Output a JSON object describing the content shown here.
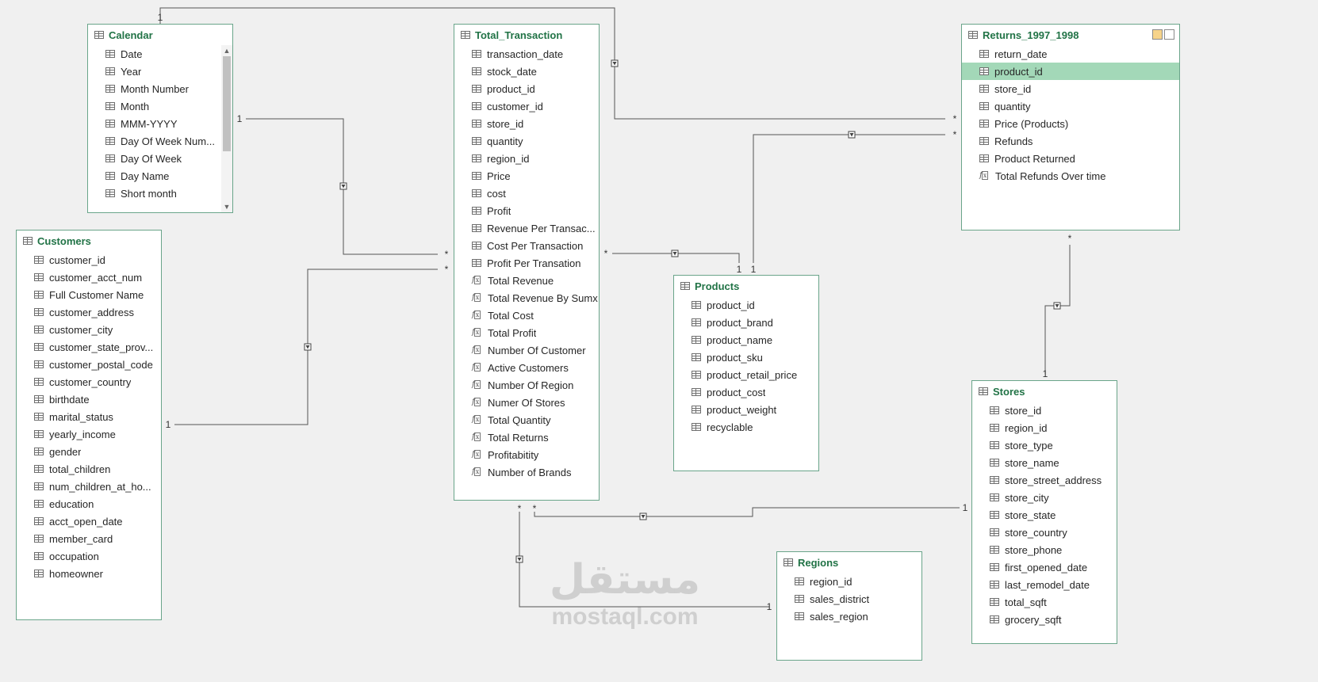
{
  "tables": [
    {
      "id": "calendar",
      "name": "Calendar",
      "scroll": true,
      "fields": [
        {
          "label": "Date",
          "kind": "col"
        },
        {
          "label": "Year",
          "kind": "col"
        },
        {
          "label": "Month Number",
          "kind": "col"
        },
        {
          "label": "Month",
          "kind": "col"
        },
        {
          "label": "MMM-YYYY",
          "kind": "col"
        },
        {
          "label": "Day Of Week Num...",
          "kind": "col"
        },
        {
          "label": "Day Of Week",
          "kind": "col"
        },
        {
          "label": "Day Name",
          "kind": "col"
        },
        {
          "label": "Short month",
          "kind": "col"
        }
      ]
    },
    {
      "id": "total_transaction",
      "name": "Total_Transaction",
      "fields": [
        {
          "label": "transaction_date",
          "kind": "col"
        },
        {
          "label": "stock_date",
          "kind": "col"
        },
        {
          "label": "product_id",
          "kind": "col"
        },
        {
          "label": "customer_id",
          "kind": "col"
        },
        {
          "label": "store_id",
          "kind": "col"
        },
        {
          "label": "quantity",
          "kind": "col"
        },
        {
          "label": "region_id",
          "kind": "col"
        },
        {
          "label": "Price",
          "kind": "col"
        },
        {
          "label": "cost",
          "kind": "col"
        },
        {
          "label": "Profit",
          "kind": "col"
        },
        {
          "label": "Revenue Per Transac...",
          "kind": "col"
        },
        {
          "label": "Cost Per Transaction",
          "kind": "col"
        },
        {
          "label": "Profit Per Transation",
          "kind": "col"
        },
        {
          "label": "Total Revenue",
          "kind": "measure"
        },
        {
          "label": "Total Revenue By Sumx",
          "kind": "measure"
        },
        {
          "label": "Total Cost",
          "kind": "measure"
        },
        {
          "label": "Total Profit",
          "kind": "measure"
        },
        {
          "label": "Number Of Customer",
          "kind": "measure"
        },
        {
          "label": "Active Customers",
          "kind": "measure"
        },
        {
          "label": "Number Of Region",
          "kind": "measure"
        },
        {
          "label": "Numer Of Stores",
          "kind": "measure"
        },
        {
          "label": "Total Quantity",
          "kind": "measure"
        },
        {
          "label": "Total Returns",
          "kind": "measure"
        },
        {
          "label": "Profitabitity",
          "kind": "measure"
        },
        {
          "label": "Number of Brands",
          "kind": "measure"
        }
      ]
    },
    {
      "id": "returns",
      "name": "Returns_1997_1998",
      "buttons": true,
      "fields": [
        {
          "label": "return_date",
          "kind": "col"
        },
        {
          "label": "product_id",
          "kind": "col",
          "selected": true
        },
        {
          "label": "store_id",
          "kind": "col"
        },
        {
          "label": "quantity",
          "kind": "col"
        },
        {
          "label": "Price (Products)",
          "kind": "col"
        },
        {
          "label": "Refunds",
          "kind": "col"
        },
        {
          "label": "Product Returned",
          "kind": "col"
        },
        {
          "label": "Total Refunds Over time",
          "kind": "measure"
        }
      ]
    },
    {
      "id": "customers",
      "name": "Customers",
      "fields": [
        {
          "label": "customer_id",
          "kind": "col"
        },
        {
          "label": "customer_acct_num",
          "kind": "col"
        },
        {
          "label": "Full Customer Name",
          "kind": "col"
        },
        {
          "label": "customer_address",
          "kind": "col"
        },
        {
          "label": "customer_city",
          "kind": "col"
        },
        {
          "label": "customer_state_prov...",
          "kind": "col"
        },
        {
          "label": "customer_postal_code",
          "kind": "col"
        },
        {
          "label": "customer_country",
          "kind": "col"
        },
        {
          "label": "birthdate",
          "kind": "col"
        },
        {
          "label": "marital_status",
          "kind": "col"
        },
        {
          "label": "yearly_income",
          "kind": "col"
        },
        {
          "label": "gender",
          "kind": "col"
        },
        {
          "label": "total_children",
          "kind": "col"
        },
        {
          "label": "num_children_at_ho...",
          "kind": "col"
        },
        {
          "label": "education",
          "kind": "col"
        },
        {
          "label": "acct_open_date",
          "kind": "col"
        },
        {
          "label": "member_card",
          "kind": "col"
        },
        {
          "label": "occupation",
          "kind": "col"
        },
        {
          "label": "homeowner",
          "kind": "col"
        }
      ]
    },
    {
      "id": "products",
      "name": "Products",
      "fields": [
        {
          "label": "product_id",
          "kind": "col"
        },
        {
          "label": "product_brand",
          "kind": "col"
        },
        {
          "label": "product_name",
          "kind": "col"
        },
        {
          "label": "product_sku",
          "kind": "col"
        },
        {
          "label": "product_retail_price",
          "kind": "col"
        },
        {
          "label": "product_cost",
          "kind": "col"
        },
        {
          "label": "product_weight",
          "kind": "col"
        },
        {
          "label": "recyclable",
          "kind": "col"
        }
      ]
    },
    {
      "id": "stores",
      "name": "Stores",
      "fields": [
        {
          "label": "store_id",
          "kind": "col"
        },
        {
          "label": "region_id",
          "kind": "col"
        },
        {
          "label": "store_type",
          "kind": "col"
        },
        {
          "label": "store_name",
          "kind": "col"
        },
        {
          "label": "store_street_address",
          "kind": "col"
        },
        {
          "label": "store_city",
          "kind": "col"
        },
        {
          "label": "store_state",
          "kind": "col"
        },
        {
          "label": "store_country",
          "kind": "col"
        },
        {
          "label": "store_phone",
          "kind": "col"
        },
        {
          "label": "first_opened_date",
          "kind": "col"
        },
        {
          "label": "last_remodel_date",
          "kind": "col"
        },
        {
          "label": "total_sqft",
          "kind": "col"
        },
        {
          "label": "grocery_sqft",
          "kind": "col"
        }
      ]
    },
    {
      "id": "regions",
      "name": "Regions",
      "fields": [
        {
          "label": "region_id",
          "kind": "col"
        },
        {
          "label": "sales_district",
          "kind": "col"
        },
        {
          "label": "sales_region",
          "kind": "col"
        }
      ]
    }
  ],
  "relationships": [
    {
      "from": "calendar",
      "to": "returns",
      "from_card": "1",
      "to_card": "*"
    },
    {
      "from": "calendar",
      "to": "total_transaction",
      "from_card": "1",
      "to_card": "*"
    },
    {
      "from": "customers",
      "to": "total_transaction",
      "from_card": "1",
      "to_card": "*"
    },
    {
      "from": "products",
      "to": "total_transaction",
      "from_card": "1",
      "to_card": "*"
    },
    {
      "from": "products",
      "to": "returns",
      "from_card": "1",
      "to_card": "*"
    },
    {
      "from": "stores",
      "to": "returns",
      "from_card": "1",
      "to_card": "*"
    },
    {
      "from": "stores",
      "to": "total_transaction",
      "from_card": "1",
      "to_card": "*"
    },
    {
      "from": "regions",
      "to": "total_transaction",
      "from_card": "1",
      "to_card": "*"
    }
  ],
  "watermark": {
    "arabic": "مستقل",
    "latin": "mostaql.com"
  }
}
